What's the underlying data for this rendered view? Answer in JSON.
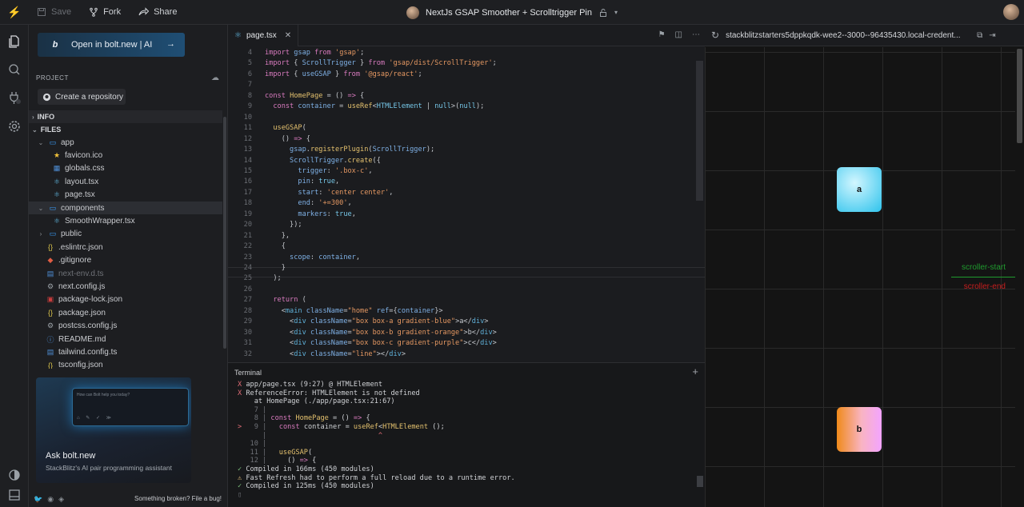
{
  "toolbar": {
    "save": "Save",
    "fork": "Fork",
    "share": "Share"
  },
  "project_title": "NextJs GSAP Smoother + Scrolltrigger Pin",
  "sidebar": {
    "bolt_button": "Open in bolt.new | AI",
    "project_label": "PROJECT",
    "repo_button": "Create a repository",
    "info_label": "INFO",
    "files_label": "FILES",
    "files": [
      {
        "name": "app",
        "kind": "folder",
        "depth": 0,
        "open": true
      },
      {
        "name": "favicon.ico",
        "kind": "favicon",
        "depth": 1
      },
      {
        "name": "globals.css",
        "kind": "css",
        "depth": 1
      },
      {
        "name": "layout.tsx",
        "kind": "react",
        "depth": 1
      },
      {
        "name": "page.tsx",
        "kind": "react",
        "depth": 1
      },
      {
        "name": "components",
        "kind": "folder",
        "depth": 0,
        "open": true,
        "selected": true
      },
      {
        "name": "SmoothWrapper.tsx",
        "kind": "react",
        "depth": 1
      },
      {
        "name": "public",
        "kind": "folder",
        "depth": 0,
        "open": false
      },
      {
        "name": ".eslintrc.json",
        "kind": "json",
        "depth": 0
      },
      {
        "name": ".gitignore",
        "kind": "git",
        "depth": 0
      },
      {
        "name": "next-env.d.ts",
        "kind": "ts",
        "depth": 0,
        "dim": true
      },
      {
        "name": "next.config.js",
        "kind": "gear",
        "depth": 0
      },
      {
        "name": "package-lock.json",
        "kind": "npm",
        "depth": 0
      },
      {
        "name": "package.json",
        "kind": "json",
        "depth": 0
      },
      {
        "name": "postcss.config.js",
        "kind": "gear",
        "depth": 0
      },
      {
        "name": "README.md",
        "kind": "md",
        "depth": 0
      },
      {
        "name": "tailwind.config.ts",
        "kind": "ts",
        "depth": 0
      },
      {
        "name": "tsconfig.json",
        "kind": "json",
        "depth": 0
      }
    ],
    "ask_title": "Ask bolt.new",
    "ask_subtitle": "StackBlitz's AI pair programming assistant",
    "ask_placeholder": "How can Bolt help you today?",
    "footer_link": "Something broken? File a bug!"
  },
  "editor": {
    "tab_name": "page.tsx",
    "lines": [
      {
        "n": "4",
        "c": "<span class='kw'>import</span> <span class='va'>gsap</span> <span class='kw'>from</span> <span class='str'>'gsap'</span>;"
      },
      {
        "n": "5",
        "c": "<span class='kw'>import</span> { <span class='va'>ScrollTrigger</span> } <span class='kw'>from</span> <span class='str'>'gsap/dist/ScrollTrigger'</span>;"
      },
      {
        "n": "6",
        "c": "<span class='kw'>import</span> { <span class='va'>useGSAP</span> } <span class='kw'>from</span> <span class='str'>'@gsap/react'</span>;"
      },
      {
        "n": "7",
        "c": ""
      },
      {
        "n": "8",
        "c": "<span class='kw'>const</span> <span class='fn'>HomePage</span> = () <span class='kw'>=&gt;</span> {"
      },
      {
        "n": "9",
        "c": "  <span class='kw'>const</span> <span class='va'>container</span> = <span class='fn'>useRef</span>&lt;<span class='ty'>HTMLElement</span> | <span class='ty'>null</span>&gt;(<span class='ty'>null</span>);"
      },
      {
        "n": "10",
        "c": ""
      },
      {
        "n": "11",
        "c": "  <span class='fn'>useGSAP</span>("
      },
      {
        "n": "12",
        "c": "    () <span class='kw'>=&gt;</span> {"
      },
      {
        "n": "13",
        "c": "      <span class='va'>gsap</span>.<span class='fn'>registerPlugin</span>(<span class='va'>ScrollTrigger</span>);"
      },
      {
        "n": "14",
        "c": "      <span class='va'>ScrollTrigger</span>.<span class='fn'>create</span>({"
      },
      {
        "n": "15",
        "c": "        <span class='va'>trigger</span>: <span class='str'>'.box-c'</span>,"
      },
      {
        "n": "16",
        "c": "        <span class='va'>pin</span>: <span class='ty'>true</span>,"
      },
      {
        "n": "17",
        "c": "        <span class='va'>start</span>: <span class='str'>'center center'</span>,"
      },
      {
        "n": "18",
        "c": "        <span class='va'>end</span>: <span class='str'>'+=300'</span>,"
      },
      {
        "n": "19",
        "c": "        <span class='va'>markers</span>: <span class='ty'>true</span>,"
      },
      {
        "n": "20",
        "c": "      });"
      },
      {
        "n": "21",
        "c": "    },"
      },
      {
        "n": "22",
        "c": "    {"
      },
      {
        "n": "23",
        "c": "      <span class='va'>scope</span>: <span class='va'>container</span>,"
      },
      {
        "n": "24",
        "c": "    }"
      },
      {
        "n": "25",
        "c": "  );"
      },
      {
        "n": "26",
        "c": ""
      },
      {
        "n": "27",
        "c": "  <span class='kw'>return</span> ("
      },
      {
        "n": "28",
        "c": "    &lt;<span class='jsx'>main</span> <span class='va'>className</span>=<span class='str'>\"home\"</span> <span class='va'>ref</span>={<span class='va'>container</span>}&gt;"
      },
      {
        "n": "29",
        "c": "      &lt;<span class='jsx'>div</span> <span class='va'>className</span>=<span class='str'>\"box box-a gradient-blue\"</span>&gt;a&lt;/<span class='jsx'>div</span>&gt;"
      },
      {
        "n": "30",
        "c": "      &lt;<span class='jsx'>div</span> <span class='va'>className</span>=<span class='str'>\"box box-b gradient-orange\"</span>&gt;b&lt;/<span class='jsx'>div</span>&gt;"
      },
      {
        "n": "31",
        "c": "      &lt;<span class='jsx'>div</span> <span class='va'>className</span>=<span class='str'>\"box box-c gradient-purple\"</span>&gt;c&lt;/<span class='jsx'>div</span>&gt;"
      },
      {
        "n": "32",
        "c": "      &lt;<span class='jsx'>div</span> <span class='va'>className</span>=<span class='str'>\"line\"</span>&gt;&lt;/<span class='jsx'>div</span>&gt;"
      }
    ]
  },
  "terminal": {
    "title": "Terminal",
    "lines": [
      {
        "c": "<span class='red'>X</span> app/page.tsx (9:27) @ HTMLElement"
      },
      {
        "c": "<span class='red'>X</span> ReferenceError: HTMLElement is not defined"
      },
      {
        "c": "    at HomePage (./app/page.tsx:21:67)"
      },
      {
        "c": "<span class='dim'>    7 |</span>"
      },
      {
        "c": "<span class='dim'>    8 |</span> <span class='kw'>const</span> <span class='fn'>HomePage</span> = () <span class='kw'>=&gt;</span> {"
      },
      {
        "c": "<span class='red'>&gt;</span> <span class='dim'>  9 |</span>   <span class='kw'>const</span> container = <span class='fn'>useRef</span>&lt;<span class='fn'>HTMLElement</span> ();"
      },
      {
        "c": "<span class='dim'>      |</span>                           <span class='red'>^</span>"
      },
      {
        "c": "<span class='dim'>   10 |</span>"
      },
      {
        "c": "<span class='dim'>   11 |</span>   <span class='fn'>useGSAP</span>("
      },
      {
        "c": "<span class='dim'>   12 |</span>     () <span class='kw'>=&gt;</span> {"
      },
      {
        "c": "<span class='green'>✓</span> Compiled in 166ms (450 modules)"
      },
      {
        "c": "<span class='yellow'>⚠</span> Fast Refresh had to perform a full reload due to a runtime error."
      },
      {
        "c": "<span class='green'>✓</span> Compiled in 125ms (450 modules)"
      },
      {
        "c": "<span class='dim'>▯</span>"
      }
    ]
  },
  "preview": {
    "url": "stackblitzstarters5dppkqdk-wee2--3000--96435430.local-credent...",
    "box_a": "a",
    "box_b": "b",
    "marker_start": "scroller-start",
    "marker_end": "scroller-end"
  },
  "colors": {
    "accent": "#2f9bf0",
    "marker_start": "#1f9b2e",
    "marker_end": "#c81e1e"
  }
}
